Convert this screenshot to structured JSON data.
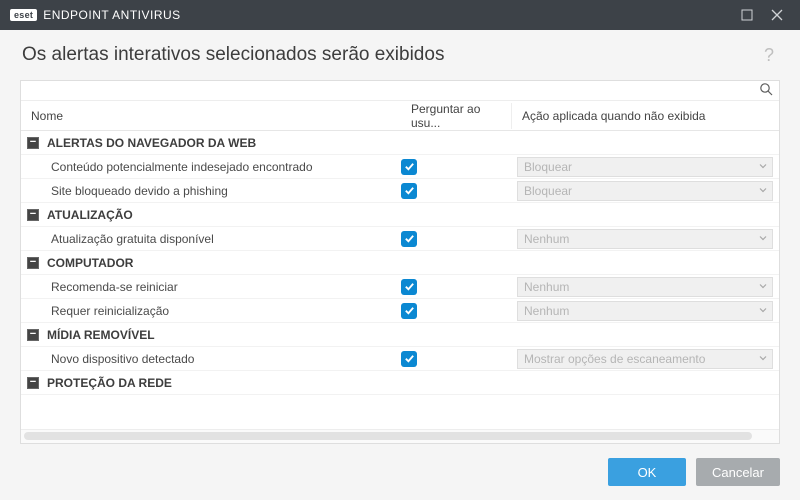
{
  "titlebar": {
    "brand": "eset",
    "product": "ENDPOINT ANTIVIRUS"
  },
  "header": {
    "title": "Os alertas interativos selecionados serão exibidos"
  },
  "columns": {
    "name": "Nome",
    "ask": "Perguntar ao usu...",
    "action": "Ação aplicada quando não exibida"
  },
  "groups": [
    {
      "label": "ALERTAS DO NAVEGADOR DA WEB",
      "items": [
        {
          "label": "Conteúdo potencialmente indesejado encontrado",
          "checked": true,
          "action": "Bloquear"
        },
        {
          "label": "Site bloqueado devido a phishing",
          "checked": true,
          "action": "Bloquear"
        }
      ]
    },
    {
      "label": "ATUALIZAÇÃO",
      "items": [
        {
          "label": "Atualização gratuita disponível",
          "checked": true,
          "action": "Nenhum"
        }
      ]
    },
    {
      "label": "COMPUTADOR",
      "items": [
        {
          "label": "Recomenda-se reiniciar",
          "checked": true,
          "action": "Nenhum"
        },
        {
          "label": "Requer reinicialização",
          "checked": true,
          "action": "Nenhum"
        }
      ]
    },
    {
      "label": "MÍDIA REMOVÍVEL",
      "items": [
        {
          "label": "Novo dispositivo detectado",
          "checked": true,
          "action": "Mostrar opções de escaneamento"
        }
      ]
    },
    {
      "label": "PROTEÇÃO DA REDE",
      "items": []
    }
  ],
  "footer": {
    "ok": "OK",
    "cancel": "Cancelar"
  }
}
